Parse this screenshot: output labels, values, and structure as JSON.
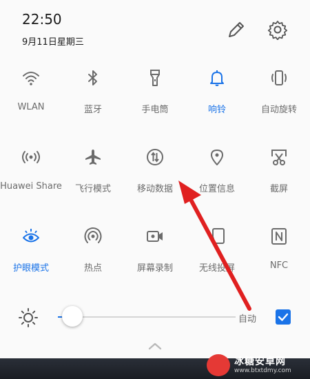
{
  "status": {
    "time": "22:50",
    "date": "9月11日星期三"
  },
  "header_icons": [
    "edit-icon",
    "settings-gear-icon"
  ],
  "tiles": [
    {
      "label": "WLAN",
      "icon": "wifi-icon",
      "active": false
    },
    {
      "label": "蓝牙",
      "icon": "bluetooth-icon",
      "active": false
    },
    {
      "label": "手电筒",
      "icon": "flashlight-icon",
      "active": false
    },
    {
      "label": "响铃",
      "icon": "bell-icon",
      "active": true
    },
    {
      "label": "自动旋转",
      "icon": "auto-rotate-icon",
      "active": false
    },
    {
      "label": "Huawei Share",
      "icon": "huawei-share-icon",
      "active": false
    },
    {
      "label": "飞行模式",
      "icon": "airplane-icon",
      "active": false
    },
    {
      "label": "移动数据",
      "icon": "mobile-data-icon",
      "active": false
    },
    {
      "label": "位置信息",
      "icon": "location-icon",
      "active": false
    },
    {
      "label": "截屏",
      "icon": "screenshot-icon",
      "active": false
    },
    {
      "label": "护眼模式",
      "icon": "eye-comfort-icon",
      "active": true
    },
    {
      "label": "热点",
      "icon": "hotspot-icon",
      "active": false
    },
    {
      "label": "屏幕录制",
      "icon": "screen-record-icon",
      "active": false
    },
    {
      "label": "无线投屏",
      "icon": "wireless-projection-icon",
      "active": false
    },
    {
      "label": "NFC",
      "icon": "nfc-icon",
      "active": false
    }
  ],
  "brightness": {
    "auto_label": "自动",
    "auto_checked": true,
    "level": 0.02
  },
  "colors": {
    "accent": "#1a73e8",
    "annotation_arrow": "#e02020",
    "label_gray": "#6b6b6b"
  },
  "watermark": {
    "title": "冰糖安卓网",
    "url": "www.btxtdmy.com"
  }
}
